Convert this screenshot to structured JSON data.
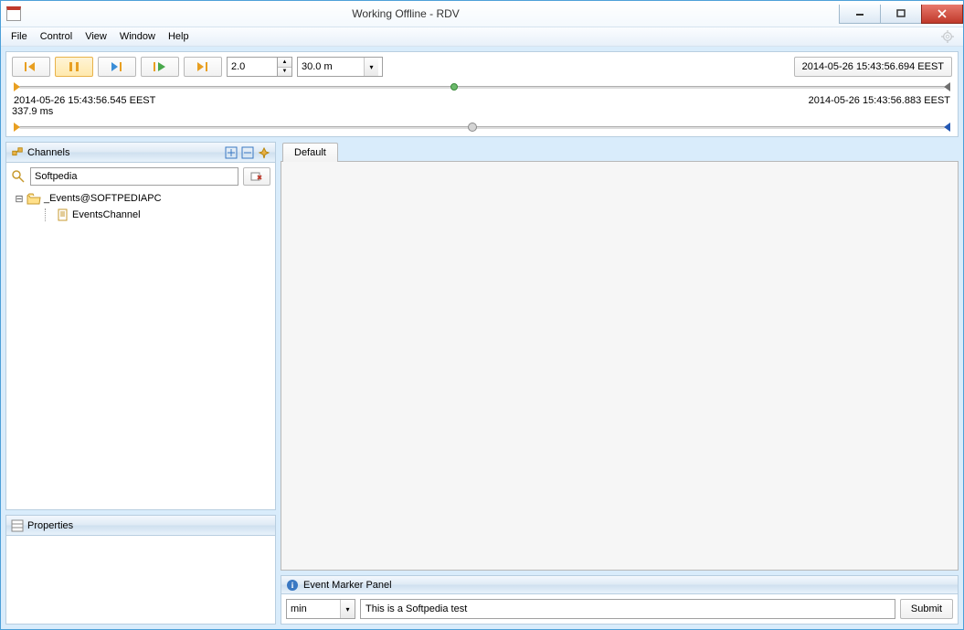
{
  "window": {
    "title": "Working Offline - RDV"
  },
  "menu": {
    "items": [
      "File",
      "Control",
      "View",
      "Window",
      "Help"
    ]
  },
  "toolbar": {
    "speed_value": "2.0",
    "span_value": "30.0 m",
    "current_timestamp": "2014-05-26 15:43:56.694 EEST"
  },
  "timeline": {
    "start_time": "2014-05-26 15:43:56.545 EEST",
    "end_time": "2014-05-26 15:43:56.883 EEST",
    "duration": "337.9 ms",
    "marker1_percent": 47,
    "marker2_percent": 49
  },
  "channels": {
    "title": "Channels",
    "search_value": "Softpedia",
    "tree": {
      "root_label": "_Events@SOFTPEDIAPC",
      "child_label": "EventsChannel"
    }
  },
  "properties": {
    "title": "Properties"
  },
  "tabs": {
    "active": "Default"
  },
  "event_marker": {
    "title": "Event Marker Panel",
    "unit": "min",
    "text": "This is a Softpedia test",
    "submit_label": "Submit"
  }
}
